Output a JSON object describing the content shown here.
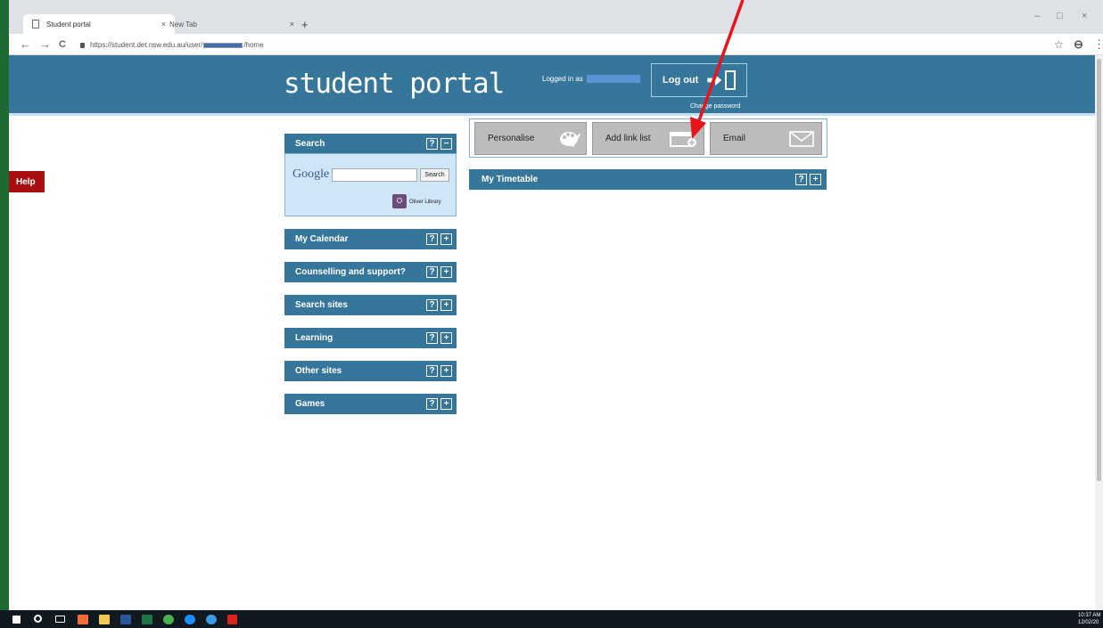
{
  "browser": {
    "tabs": [
      {
        "label": "Student portal",
        "close": "×"
      },
      {
        "label": "New Tab",
        "close": "×"
      }
    ],
    "new_tab": "+",
    "window_controls": [
      "–",
      "□",
      "×"
    ],
    "nav": {
      "back": "←",
      "forward": "→",
      "reload": "C"
    },
    "url_prefix": "https://student.det.nsw.edu.au/user/",
    "url_suffix": "/home",
    "star": "☆",
    "profile": "⊖",
    "menu": "⋮"
  },
  "header": {
    "title": "student portal",
    "logged_in_label": "Logged in as",
    "logout_label": "Log out",
    "change_password": "Change password"
  },
  "help": {
    "label": "Help"
  },
  "toolbar": {
    "buttons": [
      {
        "label": "Personalise",
        "icon": "palette-icon"
      },
      {
        "label": "Add link list",
        "icon": "add-window-icon"
      },
      {
        "label": "Email",
        "icon": "envelope-icon"
      }
    ]
  },
  "panels": {
    "search": {
      "title": "Search",
      "help": "?",
      "toggle": "−",
      "google_logo": "Google",
      "search_button": "Search",
      "library_label": "Oliver Library",
      "library_icon_text": "O"
    },
    "items": [
      {
        "title": "My Calendar",
        "help": "?",
        "toggle": "+"
      },
      {
        "title": "Counselling and support?",
        "help": "?",
        "toggle": "+"
      },
      {
        "title": "Search sites",
        "help": "?",
        "toggle": "+"
      },
      {
        "title": "Learning",
        "help": "?",
        "toggle": "+"
      },
      {
        "title": "Other sites",
        "help": "?",
        "toggle": "+"
      },
      {
        "title": "Games",
        "help": "?",
        "toggle": "+"
      }
    ]
  },
  "timetable": {
    "title": "My Timetable",
    "help": "?",
    "toggle": "+"
  },
  "annotation": {
    "color": "#e8141b"
  },
  "taskbar": {
    "time": "10:37 AM",
    "date": "12/02/20"
  },
  "colors": {
    "header": "#36769a",
    "help": "#a80f10",
    "panel_body": "#cfe6f6",
    "tool_button": "#bcbcbc"
  }
}
